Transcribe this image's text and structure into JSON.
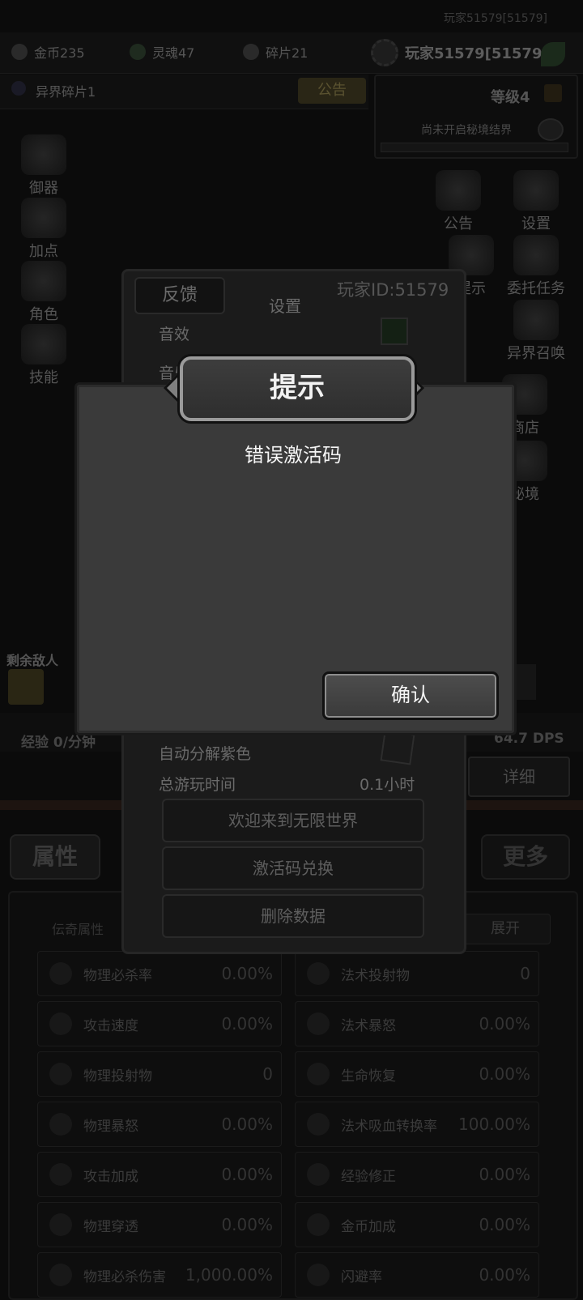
{
  "top_right_label": "玩家51579[51579]",
  "resources": [
    {
      "icon": "coin-icon",
      "label": "金币235"
    },
    {
      "icon": "soul-icon",
      "label": "灵魂47"
    },
    {
      "icon": "shard-icon",
      "label": "碎片21"
    }
  ],
  "player_name": "玩家51579[51579]",
  "fragment_label": "异界碎片1",
  "notice_button": "公告",
  "level_label": "等级4",
  "secret_label": "尚未开启秘境结界",
  "left_menu": [
    "御器",
    "加点",
    "角色",
    "技能"
  ],
  "right_menu": [
    "公告",
    "设置",
    "提示",
    "委托任务",
    "异界召唤",
    "商店",
    "秘境"
  ],
  "remaining_enemies": "剩余敌人",
  "exp_label": "经验 0/分钟",
  "dps_label": "64.7 DPS",
  "detail_button": "详细",
  "attr_tab": "属性",
  "more_tab": "更多",
  "expand_button": "展开",
  "attr_header": "伝奇属性",
  "settings": {
    "feedback_button": "反馈",
    "title": "设置",
    "player_id": "玩家ID:51579",
    "sound_effect": "音效",
    "music": "音乐",
    "auto_decompose": "自动分解紫色",
    "total_play_time_label": "总游玩时间",
    "total_play_time_value": "0.1小时",
    "welcome_button": "欢迎来到无限世界",
    "redeem_button": "激活码兑换",
    "delete_button": "删除数据"
  },
  "modal": {
    "title": "提示",
    "message": "错误激活码",
    "confirm": "确认"
  },
  "attributes_left": [
    {
      "name": "物理必杀率",
      "value": "0.00%"
    },
    {
      "name": "攻击速度",
      "value": "0.00%"
    },
    {
      "name": "物理投射物",
      "value": "0"
    },
    {
      "name": "物理暴怒",
      "value": "0.00%"
    },
    {
      "name": "攻击加成",
      "value": "0.00%"
    },
    {
      "name": "物理穿透",
      "value": "0.00%"
    },
    {
      "name": "物理必杀伤害",
      "value": "1,000.00%"
    }
  ],
  "attributes_right": [
    {
      "name": "法术投射物",
      "value": "0"
    },
    {
      "name": "法术暴怒",
      "value": "0.00%"
    },
    {
      "name": "生命恢复",
      "value": "0.00%"
    },
    {
      "name": "法术吸血转换率",
      "value": "100.00%"
    },
    {
      "name": "经验修正",
      "value": "0.00%"
    },
    {
      "name": "金币加成",
      "value": "0.00%"
    },
    {
      "name": "闪避率",
      "value": "0.00%"
    }
  ]
}
